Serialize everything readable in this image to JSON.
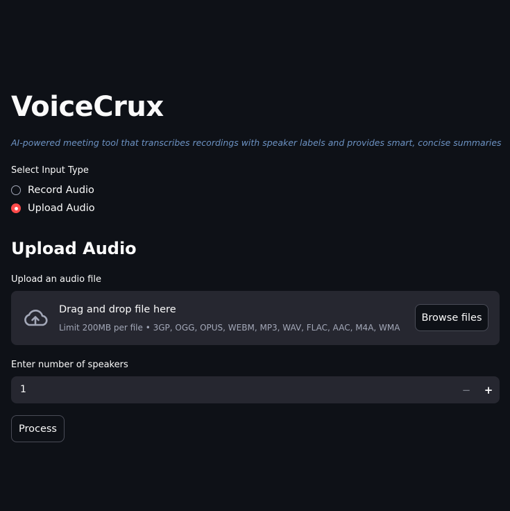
{
  "app": {
    "title": "VoiceCrux",
    "subtitle": "AI-powered meeting tool that transcribes recordings with speaker labels and provides smart, concise summaries"
  },
  "input_type": {
    "label": "Select Input Type",
    "options": [
      {
        "label": "Record Audio",
        "selected": false
      },
      {
        "label": "Upload Audio",
        "selected": true
      }
    ]
  },
  "upload_section": {
    "heading": "Upload Audio",
    "uploader_label": "Upload an audio file",
    "dropzone_title": "Drag and drop file here",
    "dropzone_limit": "Limit 200MB per file • 3GP, OGG, OPUS, WEBM, MP3, WAV, FLAC, AAC, M4A, WMA",
    "browse_label": "Browse files"
  },
  "speakers": {
    "label": "Enter number of speakers",
    "value": "1",
    "decrement_glyph": "−",
    "increment_glyph": "+"
  },
  "process_label": "Process",
  "colors": {
    "background": "#0e1117",
    "widget_bg": "#262730",
    "accent": "#ff4b4b",
    "subtitle": "#6d93c4",
    "muted_text": "#a3a8b8"
  },
  "icons": {
    "upload": "cloud-upload-icon"
  }
}
